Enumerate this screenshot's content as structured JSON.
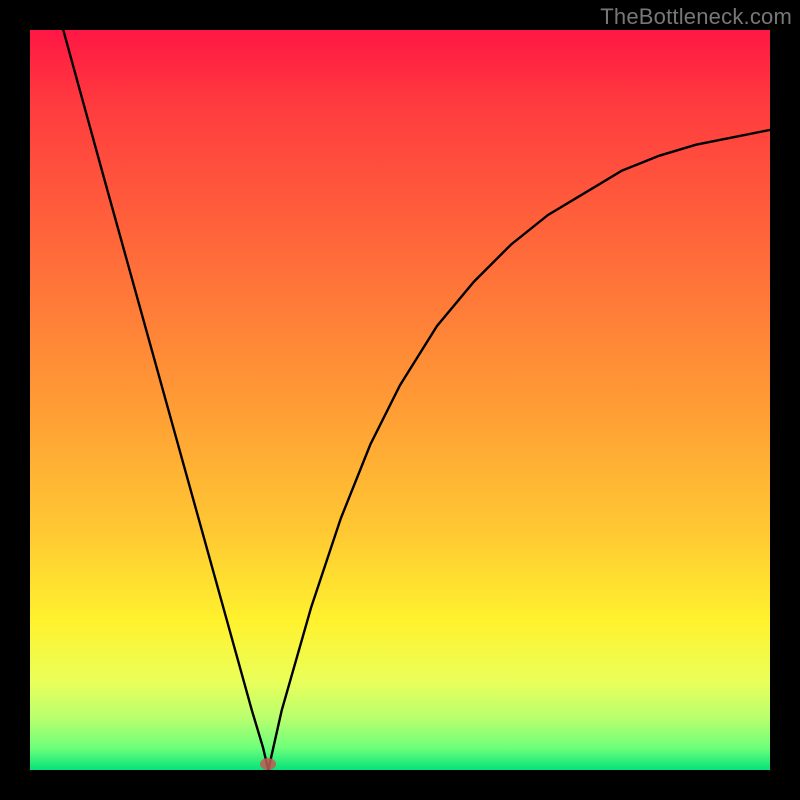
{
  "watermark": "TheBottleneck.com",
  "marker": {
    "x_frac": 0.322,
    "y_frac": 0.995
  },
  "chart_data": {
    "type": "line",
    "title": "",
    "xlabel": "",
    "ylabel": "",
    "xlim": [
      0,
      1
    ],
    "ylim": [
      0,
      1
    ],
    "annotations": [
      "TheBottleneck.com"
    ],
    "series": [
      {
        "name": "left-branch",
        "x": [
          0.045,
          0.1,
          0.15,
          0.2,
          0.25,
          0.3,
          0.315,
          0.322
        ],
        "y": [
          1.0,
          0.8,
          0.62,
          0.44,
          0.26,
          0.08,
          0.03,
          0.0
        ]
      },
      {
        "name": "right-branch",
        "x": [
          0.322,
          0.34,
          0.38,
          0.42,
          0.46,
          0.5,
          0.55,
          0.6,
          0.65,
          0.7,
          0.75,
          0.8,
          0.85,
          0.9,
          0.95,
          1.0
        ],
        "y": [
          0.0,
          0.08,
          0.22,
          0.34,
          0.44,
          0.52,
          0.6,
          0.66,
          0.71,
          0.75,
          0.78,
          0.81,
          0.83,
          0.845,
          0.855,
          0.865
        ]
      }
    ],
    "marker_point": {
      "x": 0.322,
      "y": 0.0
    },
    "background_gradient": {
      "orientation": "vertical",
      "stops": [
        {
          "pos": 0.0,
          "color": "#ff1744"
        },
        {
          "pos": 0.3,
          "color": "#ff6a3a"
        },
        {
          "pos": 0.5,
          "color": "#ff9a35"
        },
        {
          "pos": 0.8,
          "color": "#fff22e"
        },
        {
          "pos": 1.0,
          "color": "#06e27a"
        }
      ]
    }
  }
}
